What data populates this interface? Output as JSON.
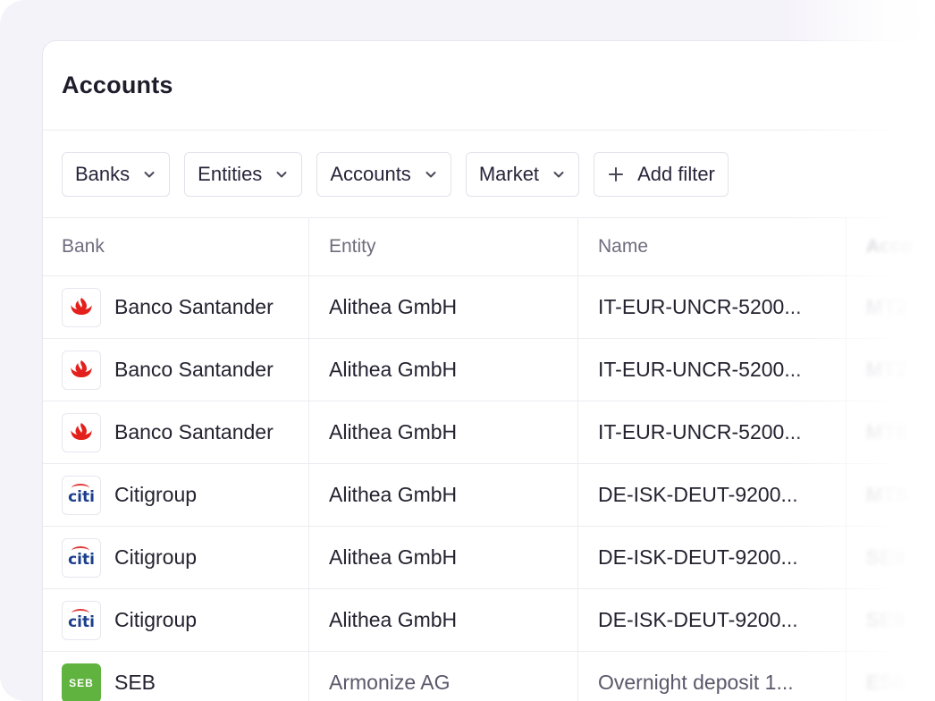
{
  "page": {
    "title": "Accounts"
  },
  "filters": [
    {
      "label": "Banks",
      "icon": "chevron-down-icon"
    },
    {
      "label": "Entities",
      "icon": "chevron-down-icon"
    },
    {
      "label": "Accounts",
      "icon": "chevron-down-icon"
    },
    {
      "label": "Market",
      "icon": "chevron-down-icon"
    }
  ],
  "add_filter": {
    "label": "Add filter",
    "icon": "plus-icon"
  },
  "table": {
    "columns": [
      "Bank",
      "Entity",
      "Name",
      "Acco"
    ],
    "rows": [
      {
        "bank": "Banco Santander",
        "logo": "santander-logo-icon",
        "entity": "Alithea GmbH",
        "name": "IT-EUR-UNCR-5200...",
        "account": "MT2"
      },
      {
        "bank": "Banco Santander",
        "logo": "santander-logo-icon",
        "entity": "Alithea GmbH",
        "name": "IT-EUR-UNCR-5200...",
        "account": "MT2"
      },
      {
        "bank": "Banco Santander",
        "logo": "santander-logo-icon",
        "entity": "Alithea GmbH",
        "name": "IT-EUR-UNCR-5200...",
        "account": "MT8"
      },
      {
        "bank": "Citigroup",
        "logo": "citi-logo-icon",
        "entity": "Alithea GmbH",
        "name": "DE-ISK-DEUT-9200...",
        "account": "MT8"
      },
      {
        "bank": "Citigroup",
        "logo": "citi-logo-icon",
        "entity": "Alithea GmbH",
        "name": "DE-ISK-DEUT-9200...",
        "account": "SE9"
      },
      {
        "bank": "Citigroup",
        "logo": "citi-logo-icon",
        "entity": "Alithea GmbH",
        "name": "DE-ISK-DEUT-9200...",
        "account": "SE9"
      },
      {
        "bank": "SEB",
        "logo": "seb-logo-icon",
        "entity": "Armonize AG",
        "name": "Overnight deposit 1...",
        "account": "ES0"
      }
    ]
  },
  "logos": {
    "citi": "citi",
    "seb": "SEB"
  },
  "colors": {
    "santander_red": "#e3201b",
    "citi_blue": "#1c3f8c",
    "citi_red": "#e03a3e",
    "seb_green": "#60b33f"
  }
}
